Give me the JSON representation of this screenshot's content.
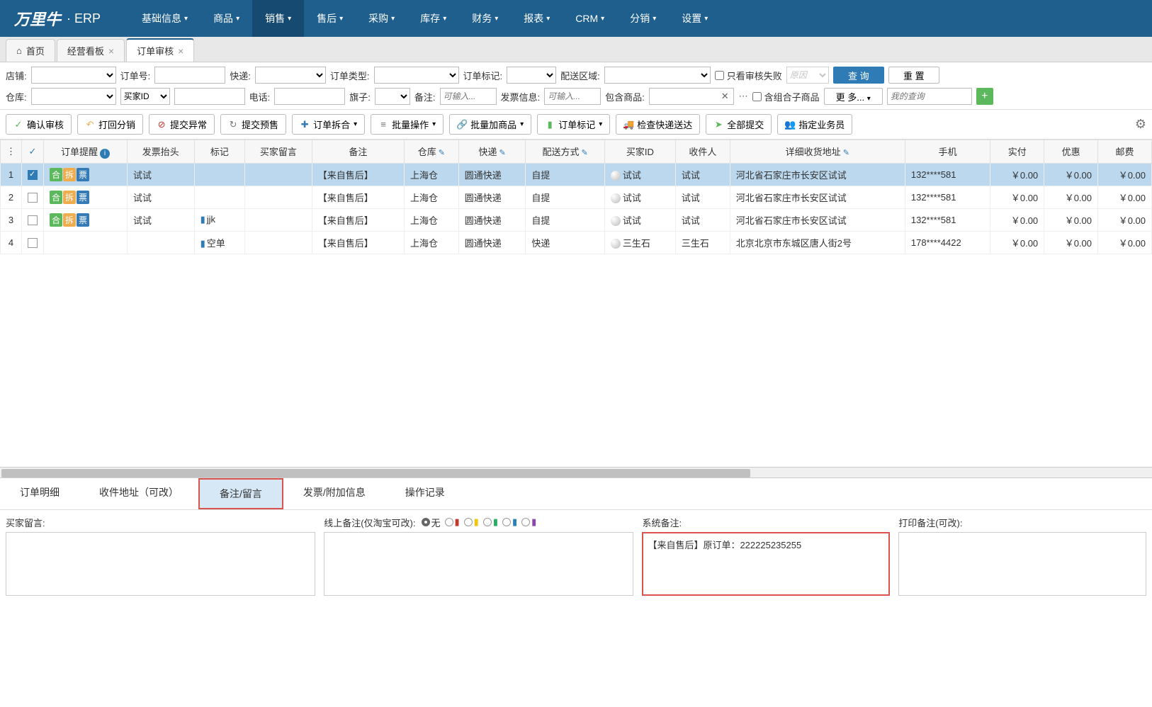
{
  "brand": {
    "logo": "万里牛",
    "suffix": "· ERP"
  },
  "nav": [
    {
      "label": "基础信息"
    },
    {
      "label": "商品"
    },
    {
      "label": "销售",
      "active": true
    },
    {
      "label": "售后"
    },
    {
      "label": "采购"
    },
    {
      "label": "库存"
    },
    {
      "label": "财务"
    },
    {
      "label": "报表"
    },
    {
      "label": "CRM"
    },
    {
      "label": "分销"
    },
    {
      "label": "设置"
    }
  ],
  "tabs": [
    {
      "label": "首页",
      "home": true
    },
    {
      "label": "经营看板",
      "closable": true
    },
    {
      "label": "订单审核",
      "closable": true,
      "active": true
    }
  ],
  "filters": {
    "row1": {
      "shop": "店铺:",
      "orderNo": "订单号:",
      "express": "快递:",
      "orderType": "订单类型:",
      "orderTag": "订单标记:",
      "region": "配送区域:",
      "onlyFail": "只看审核失败",
      "reason_ph": "原因",
      "query": "查 询",
      "reset": "重 置"
    },
    "row2": {
      "warehouse": "仓库:",
      "buyerId": "买家ID",
      "phone": "电话:",
      "flag": "旗子:",
      "remark": "备注:",
      "remark_ph": "可输入...",
      "invoice": "发票信息:",
      "invoice_ph": "可输入...",
      "contains": "包含商品:",
      "combo": "含组合子商品",
      "more": "更 多...",
      "myquery_ph": "我的查询"
    }
  },
  "toolbar": [
    {
      "icon": "✓",
      "cls": "ic-green",
      "label": "确认审核"
    },
    {
      "icon": "↶",
      "cls": "ic-orange",
      "label": "打回分销"
    },
    {
      "icon": "⊘",
      "cls": "ic-red",
      "label": "提交异常"
    },
    {
      "icon": "↻",
      "cls": "ic-gray",
      "label": "提交预售"
    },
    {
      "icon": "✚",
      "cls": "ic-blue",
      "label": "订单拆合",
      "dd": true
    },
    {
      "icon": "≡",
      "cls": "ic-gray",
      "label": "批量操作",
      "dd": true
    },
    {
      "icon": "🔗",
      "cls": "ic-gray",
      "label": "批量加商品",
      "dd": true
    },
    {
      "icon": "▮",
      "cls": "ic-green",
      "label": "订单标记",
      "dd": true
    },
    {
      "icon": "🚚",
      "cls": "ic-orange",
      "label": "检查快递送达"
    },
    {
      "icon": "➤",
      "cls": "ic-green",
      "label": "全部提交"
    },
    {
      "icon": "👥",
      "cls": "ic-gray",
      "label": "指定业务员"
    }
  ],
  "columns": [
    {
      "label": "",
      "type": "grip"
    },
    {
      "label": "",
      "type": "chkhead"
    },
    {
      "label": "订单提醒",
      "info": true
    },
    {
      "label": "发票抬头"
    },
    {
      "label": "标记"
    },
    {
      "label": "买家留言"
    },
    {
      "label": "备注"
    },
    {
      "label": "仓库",
      "edit": true
    },
    {
      "label": "快递",
      "edit": true
    },
    {
      "label": "配送方式",
      "edit": true
    },
    {
      "label": "买家ID"
    },
    {
      "label": "收件人"
    },
    {
      "label": "详细收货地址",
      "edit": true
    },
    {
      "label": "手机"
    },
    {
      "label": "实付"
    },
    {
      "label": "优惠"
    },
    {
      "label": "邮费"
    }
  ],
  "rows": [
    {
      "n": "1",
      "chk": true,
      "badges": true,
      "invoice": "试试",
      "mark": "",
      "msg": "",
      "remark": "【来自售后】",
      "wh": "上海仓",
      "exp": "圆通快递",
      "ship": "自提",
      "buyer": "试试",
      "recv": "试试",
      "addr": "河北省石家庄市长安区试试",
      "phone": "132****581",
      "pay": "￥0.00",
      "disc": "￥0.00",
      "post": "￥0.00",
      "sel": true
    },
    {
      "n": "2",
      "chk": false,
      "badges": true,
      "invoice": "试试",
      "mark": "",
      "msg": "",
      "remark": "【来自售后】",
      "wh": "上海仓",
      "exp": "圆通快递",
      "ship": "自提",
      "buyer": "试试",
      "recv": "试试",
      "addr": "河北省石家庄市长安区试试",
      "phone": "132****581",
      "pay": "￥0.00",
      "disc": "￥0.00",
      "post": "￥0.00"
    },
    {
      "n": "3",
      "chk": false,
      "badges": true,
      "invoice": "试试",
      "mark": "jjk",
      "msg": "",
      "remark": "【来自售后】",
      "wh": "上海仓",
      "exp": "圆通快递",
      "ship": "自提",
      "buyer": "试试",
      "recv": "试试",
      "addr": "河北省石家庄市长安区试试",
      "phone": "132****581",
      "pay": "￥0.00",
      "disc": "￥0.00",
      "post": "￥0.00"
    },
    {
      "n": "4",
      "chk": false,
      "badges": false,
      "invoice": "",
      "mark": "空单",
      "msg": "",
      "remark": "【来自售后】",
      "wh": "上海仓",
      "exp": "圆通快递",
      "ship": "快递",
      "buyer": "三生石",
      "recv": "三生石",
      "addr": "北京北京市东城区唐人街2号",
      "phone": "178****4422",
      "pay": "￥0.00",
      "disc": "￥0.00",
      "post": "￥0.00"
    }
  ],
  "detailTabs": [
    {
      "label": "订单明细"
    },
    {
      "label": "收件地址（可改）"
    },
    {
      "label": "备注/留言",
      "active": true
    },
    {
      "label": "发票/附加信息"
    },
    {
      "label": "操作记录"
    }
  ],
  "detail": {
    "buyerMsg": "买家留言:",
    "onlineRemark": "线上备注(仅淘宝可改):",
    "none": "无",
    "sysRemark": "系统备注:",
    "sysRemarkContent": "【来自售后】原订单：222225235255",
    "printRemark": "打印备注(可改):",
    "flagColors": [
      "#c0392b",
      "#f1c40f",
      "#27ae60",
      "#2980b9",
      "#8e44ad"
    ]
  }
}
